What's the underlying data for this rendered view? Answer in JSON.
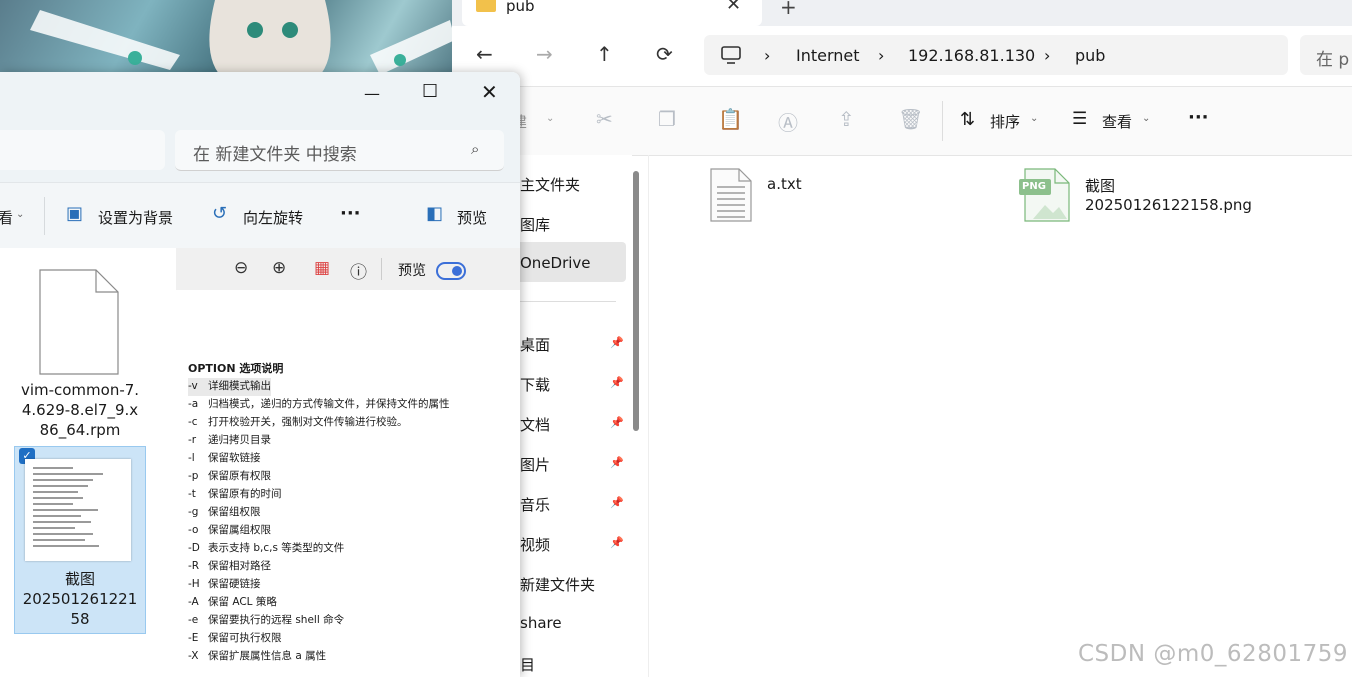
{
  "right_window": {
    "tab_title": "pub",
    "tab_close": "✕",
    "new_tab": "+",
    "breadcrumb": [
      "Internet",
      "192.168.81.130",
      "pub"
    ],
    "search_placeholder": "在 p",
    "commands": {
      "new_label": "建",
      "sort_label": "排序",
      "view_label": "查看",
      "more": "···"
    },
    "nav_items": [
      {
        "label": "主文件夹",
        "pinned": false
      },
      {
        "label": "图库",
        "pinned": false
      },
      {
        "label": "OneDrive",
        "pinned": false,
        "selected": true
      },
      {
        "label": "桌面",
        "pinned": true
      },
      {
        "label": "下载",
        "pinned": true
      },
      {
        "label": "文档",
        "pinned": true
      },
      {
        "label": "图片",
        "pinned": true
      },
      {
        "label": "音乐",
        "pinned": true
      },
      {
        "label": "视频",
        "pinned": true
      },
      {
        "label": "新建文件夹",
        "pinned": false
      },
      {
        "label": "share",
        "pinned": false
      },
      {
        "label": "目",
        "pinned": false
      }
    ],
    "files": [
      {
        "name": "a.txt",
        "type": "text"
      },
      {
        "name": "截图20250126122158.png",
        "type": "png",
        "badge": "PNG"
      }
    ]
  },
  "left_window": {
    "search_placeholder": "在 新建文件夹 中搜索",
    "toolbar": {
      "view_fragment": "看",
      "set_background": "设置为背景",
      "rotate_left": "向左旋转",
      "more": "···",
      "preview": "预览"
    },
    "files": [
      {
        "name": "vim-common-7.4.629-8.el7_9.x86_64.rpm",
        "lines": [
          "vim-common-7.",
          "4.629-8.el7_9.x",
          "86_64.rpm"
        ]
      },
      {
        "name": "截图20250126122158",
        "lines": [
          "截图",
          "202501261221",
          "58"
        ],
        "selected": true
      }
    ],
    "preview_toolbar": {
      "preview_label": "预览"
    },
    "document": {
      "heading": "OPTION 选项说明",
      "options": [
        {
          "flag": "-v",
          "desc": "详细模式输出"
        },
        {
          "flag": "-a",
          "desc": "归档模式，递归的方式传输文件，并保持文件的属性"
        },
        {
          "flag": "-c",
          "desc": "打开校验开关，强制对文件传输进行校验。"
        },
        {
          "flag": "-r",
          "desc": "递归拷贝目录"
        },
        {
          "flag": "-l",
          "desc": "保留软链接"
        },
        {
          "flag": "-p",
          "desc": "保留原有权限"
        },
        {
          "flag": "-t",
          "desc": "保留原有的时间"
        },
        {
          "flag": "-g",
          "desc": "保留组权限"
        },
        {
          "flag": "-o",
          "desc": "保留属组权限"
        },
        {
          "flag": "-D",
          "desc": "表示支持 b,c,s 等类型的文件"
        },
        {
          "flag": "-R",
          "desc": "保留相对路径"
        },
        {
          "flag": "-H",
          "desc": "保留硬链接"
        },
        {
          "flag": "-A",
          "desc": "保留 ACL 策略"
        },
        {
          "flag": "-e",
          "desc": "保留要执行的远程 shell 命令"
        },
        {
          "flag": "-E",
          "desc": "保留可执行权限"
        },
        {
          "flag": "-X",
          "desc": "保留扩展属性信息 a 属性"
        }
      ]
    }
  },
  "watermark": "CSDN @m0_62801759"
}
